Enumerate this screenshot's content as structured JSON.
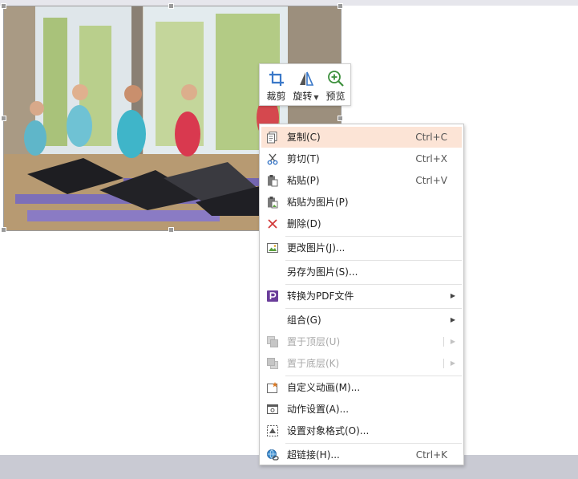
{
  "toolbar": {
    "crop_label": "裁剪",
    "rotate_label": "旋转",
    "preview_label": "预览",
    "crop_icon": "crop-icon",
    "rotate_icon": "flip-icon",
    "preview_icon": "zoom-in-icon",
    "accent_color": "#3a78c8"
  },
  "menu": {
    "highlight_color": "#fce4d6",
    "items": [
      {
        "label": "复制(C)",
        "shortcut": "Ctrl+C",
        "icon": "copy-icon"
      },
      {
        "label": "剪切(T)",
        "shortcut": "Ctrl+X",
        "icon": "scissors-icon"
      },
      {
        "label": "粘贴(P)",
        "shortcut": "Ctrl+V",
        "icon": "paste-icon"
      },
      {
        "label": "粘贴为图片(P)",
        "icon": "paste-as-image-icon"
      },
      {
        "label": "删除(D)",
        "icon": "delete-x-icon"
      },
      {
        "label": "更改图片(J)...",
        "icon": "change-picture-icon"
      },
      {
        "label": "另存为图片(S)..."
      },
      {
        "label": "转换为PDF文件",
        "icon": "pdf-icon"
      },
      {
        "label": "组合(G)"
      },
      {
        "label": "置于顶层(U)",
        "icon": "bring-to-front-icon"
      },
      {
        "label": "置于底层(K)",
        "icon": "send-to-back-icon"
      },
      {
        "label": "自定义动画(M)...",
        "icon": "custom-animation-icon"
      },
      {
        "label": "动作设置(A)...",
        "icon": "action-settings-icon"
      },
      {
        "label": "设置对象格式(O)...",
        "icon": "format-object-icon"
      },
      {
        "label": "超链接(H)...",
        "shortcut": "Ctrl+K",
        "icon": "hyperlink-icon"
      }
    ]
  }
}
